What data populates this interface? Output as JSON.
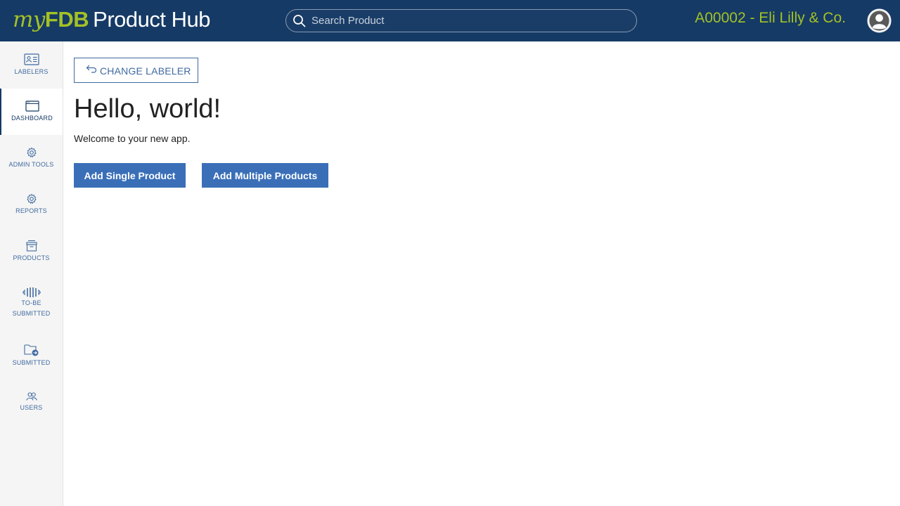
{
  "header": {
    "logo_my": "my",
    "logo_fdb": "FDB",
    "logo_product_hub": "Product Hub",
    "search_placeholder": "Search Product",
    "labeler_title": "A00002 - Eli Lilly & Co.",
    "brand_color": "#a4c126",
    "bar_color": "#153a65"
  },
  "sidebar": {
    "items": [
      {
        "label": "LABELERS",
        "icon": "labelers-icon"
      },
      {
        "label": "DASHBOARD",
        "icon": "dashboard-icon",
        "active": true
      },
      {
        "label": "ADMIN TOOLS",
        "icon": "admin-gear-icon"
      },
      {
        "label": "REPORTS",
        "icon": "reports-gear-icon"
      },
      {
        "label": "PRODUCTS",
        "icon": "products-box-icon"
      },
      {
        "label_line1": "TO-BE",
        "label_line2": "SUBMITTED",
        "icon": "to-be-submitted-icon"
      },
      {
        "label": "SUBMITTED",
        "icon": "submitted-folder-icon"
      },
      {
        "label": "USERS",
        "icon": "users-icon"
      }
    ]
  },
  "main": {
    "change_labeler_label": "CHANGE LABELER",
    "heading": "Hello, world!",
    "welcome": "Welcome to your new app.",
    "add_single_label": "Add Single Product",
    "add_multiple_label": "Add Multiple Products",
    "button_color": "#3a6fb8"
  }
}
